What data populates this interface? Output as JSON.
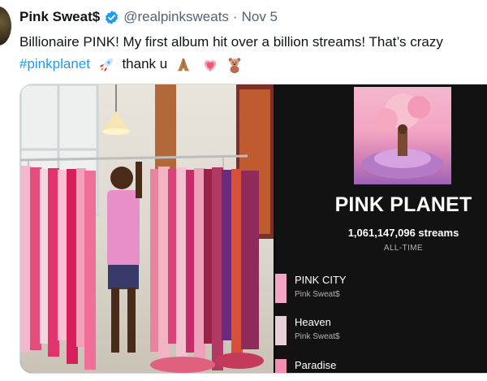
{
  "tweet": {
    "display_name": "Pink Sweat$",
    "handle": "@realpinksweats",
    "separator": "·",
    "date": "Nov 5",
    "verified": true,
    "text_line1": "Billionaire PINK! My first album hit over a billion streams! That’s crazy",
    "hashtag": "#pinkplanet",
    "text_after": "thank u",
    "emojis": [
      "rocket-emoji",
      "folded-hands-emoji",
      "sparkling-heart-emoji",
      "teddy-bear-emoji"
    ]
  },
  "spotify": {
    "album_title": "PINK PLANET",
    "streams": "1,061,147,096 streams",
    "period": "ALL-TIME",
    "tracks": [
      {
        "title": "PINK CITY",
        "artist": "Pink Sweat$"
      },
      {
        "title": "Heaven",
        "artist": "Pink Sweat$"
      },
      {
        "title": "Paradise",
        "artist": ""
      }
    ]
  },
  "colors": {
    "link": "#1d9bf0",
    "verified_badge": "#1d9bf0",
    "secondary_text": "#536471",
    "spotify_bg": "#121212"
  }
}
